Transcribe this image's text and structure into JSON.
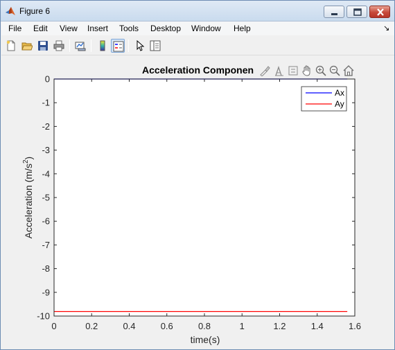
{
  "window": {
    "title": "Figure 6",
    "minimize": "minimize",
    "maximize": "maximize",
    "close": "close"
  },
  "menu": {
    "items": [
      "File",
      "Edit",
      "View",
      "Insert",
      "Tools",
      "Desktop",
      "Window",
      "Help"
    ],
    "corner_glyph": "↘"
  },
  "toolbar": {
    "icons": [
      "new-figure-icon",
      "open-file-icon",
      "save-icon",
      "print-icon",
      "link-plot-icon",
      "colorbar-icon",
      "legend-icon",
      "pointer-icon",
      "property-inspector-icon"
    ]
  },
  "axes_toolbar": {
    "icons": [
      "brush-icon",
      "data-tips-icon",
      "rotate-icon",
      "pan-icon",
      "zoom-in-icon",
      "zoom-out-icon",
      "home-icon"
    ]
  },
  "chart_data": {
    "type": "line",
    "title": "Acceleration Componen",
    "xlabel": "time(s)",
    "ylabel": "Acceleration (m/s",
    "ylabel_superscript": "2",
    "ylabel_suffix": ")",
    "xlim": [
      0,
      1.6
    ],
    "ylim": [
      -10,
      0
    ],
    "xticks": [
      0,
      0.2,
      0.4,
      0.6,
      0.8,
      1,
      1.2,
      1.4,
      1.6
    ],
    "xtick_labels": [
      "0",
      "0.2",
      "0.4",
      "0.6",
      "0.8",
      "1",
      "1.2",
      "1.4",
      "1.6"
    ],
    "yticks": [
      0,
      -1,
      -2,
      -3,
      -4,
      -5,
      -6,
      -7,
      -8,
      -9,
      -10
    ],
    "ytick_labels": [
      "0",
      "-1",
      "-2",
      "-3",
      "-4",
      "-5",
      "-6",
      "-7",
      "-8",
      "-9",
      "-10"
    ],
    "grid": false,
    "legend_position": "top-right",
    "series": [
      {
        "name": "Ax",
        "color": "#0000ff",
        "x": [
          0,
          1.56
        ],
        "y": [
          0,
          0
        ]
      },
      {
        "name": "Ay",
        "color": "#ff0000",
        "x": [
          0,
          1.56
        ],
        "y": [
          -9.81,
          -9.81
        ]
      }
    ]
  }
}
